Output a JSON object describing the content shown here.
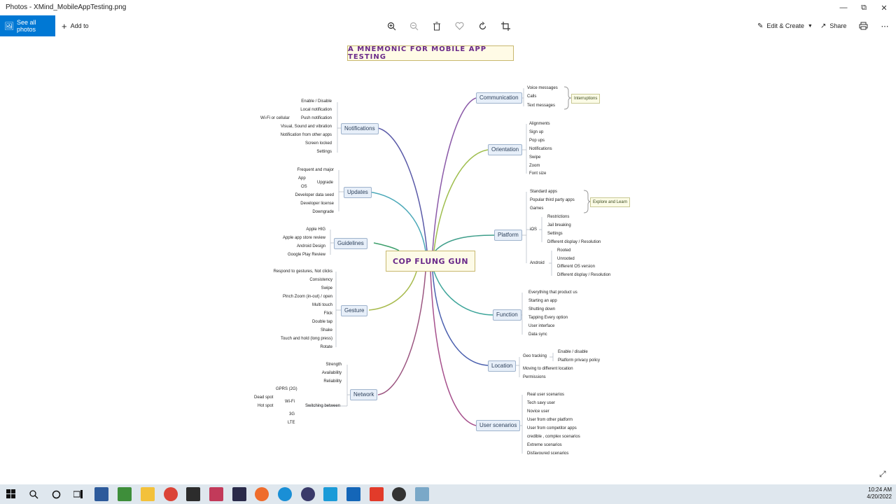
{
  "window": {
    "title": "Photos - XMind_MobileAppTesting.png",
    "minimize_icon": "minimize-icon",
    "maximize_icon": "restore-icon",
    "close_icon": "close-icon"
  },
  "toolbar": {
    "see_all_label": "See all photos",
    "add_to_label": "Add to",
    "edit_create_label": "Edit & Create",
    "share_label": "Share",
    "icons": [
      "zoom-in-icon",
      "zoom-out-icon",
      "delete-icon",
      "favorite-icon",
      "rotate-icon",
      "crop-icon",
      "print-icon",
      "more-icon"
    ]
  },
  "mindmap": {
    "title": "A MNEMONIC FOR MOBILE APP TESTING",
    "center": "COP FLUNG GUN",
    "communication": {
      "label": "Communication",
      "items": [
        "Voice messages",
        "Calls",
        "Text messages"
      ],
      "note": "Interruptions"
    },
    "orientation": {
      "label": "Orientation",
      "items": [
        "Alignments",
        "Sign up",
        "Pop ups",
        "Notifications",
        "Swipe",
        "Zoom",
        "Font size"
      ]
    },
    "platform": {
      "label": "Platform",
      "items": [
        "Standard apps",
        "Popular third party apps",
        "Games"
      ],
      "note": "Explore and Learn",
      "ios_label": "iOS",
      "ios_items": [
        "Restrictions",
        "Jail breaking",
        "Settings",
        "Different display / Resolution"
      ],
      "android_label": "Android",
      "android_items": [
        "Rooted",
        "Unrooted",
        "Different OS version",
        "Different display / Resolution"
      ]
    },
    "function": {
      "label": "Function",
      "items": [
        "Everything that product us",
        "Starting an app",
        "Shutting down",
        "Tapping Every option",
        "User interface",
        "Data sync"
      ]
    },
    "location": {
      "label": "Location",
      "geo": "Geo tracking",
      "geo_items": [
        "Enable / disable",
        "Platform privacy policy"
      ],
      "items": [
        "Moving to different location",
        "Permissions"
      ]
    },
    "user_scenarios": {
      "label": "User scenarios",
      "items": [
        "Real user scenarios",
        "Tech savy user",
        "Novice user",
        "User from other platform",
        "User from competitor apps",
        "credible , complex scenarios",
        "Extreme scenarios",
        "Disfavoured scenarios"
      ]
    },
    "notifications": {
      "label": "Notifications",
      "items": [
        "Enable / Disable",
        "Local notification",
        "Push notification",
        "Visual,  Sound and vibration",
        "Notification  from other apps",
        "Screen locked",
        "Settings"
      ],
      "wifi": "Wi-Fi or cellular"
    },
    "updates": {
      "label": "Updates",
      "items": [
        "Frequent and major",
        "Developer data seed",
        "Developer license",
        "Downgrade"
      ],
      "upgrade": "Upgrade",
      "app": "App",
      "os": "OS"
    },
    "guidelines": {
      "label": "Guidelines",
      "items": [
        "Apple HIG",
        "Apple app store review",
        "Android Design",
        "Google Play Review"
      ]
    },
    "gesture": {
      "label": "Gesture",
      "items": [
        "Respond to gestures, Not clicks",
        "Consistency",
        "Swipe",
        "Pinch Zoom (in-out) / open",
        "Multi touch",
        "Flick",
        "Double tap",
        "Shake",
        "Touch and hold (long press)",
        "Rotate"
      ]
    },
    "network": {
      "label": "Network",
      "items": [
        "Strength",
        "Availability",
        "Reliability"
      ],
      "switching": "Switching between",
      "gprs": "GPRS (2G)",
      "wifi": "Wi-Fi",
      "dead": "Dead spot",
      "hot": "Hot spot",
      "g3": "3G",
      "lte": "LTE"
    }
  },
  "taskbar": {
    "time": "10:24 AM",
    "date": "4/20/2022",
    "apps": [
      "windows-start-icon",
      "search-icon",
      "cortana-icon",
      "task-view-icon",
      "app-icon",
      "app-icon",
      "file-explorer-icon",
      "chrome-icon",
      "sticky-notes-icon",
      "app-icon",
      "intellij-icon",
      "postman-icon",
      "edge-icon",
      "app-icon",
      "app-icon",
      "photos-icon",
      "xmind-icon",
      "app-icon",
      "app-icon"
    ]
  },
  "colors": {
    "accent": "#0078d4",
    "taskbar": "#dfe7ee",
    "title_text": "#6a2a8a"
  }
}
